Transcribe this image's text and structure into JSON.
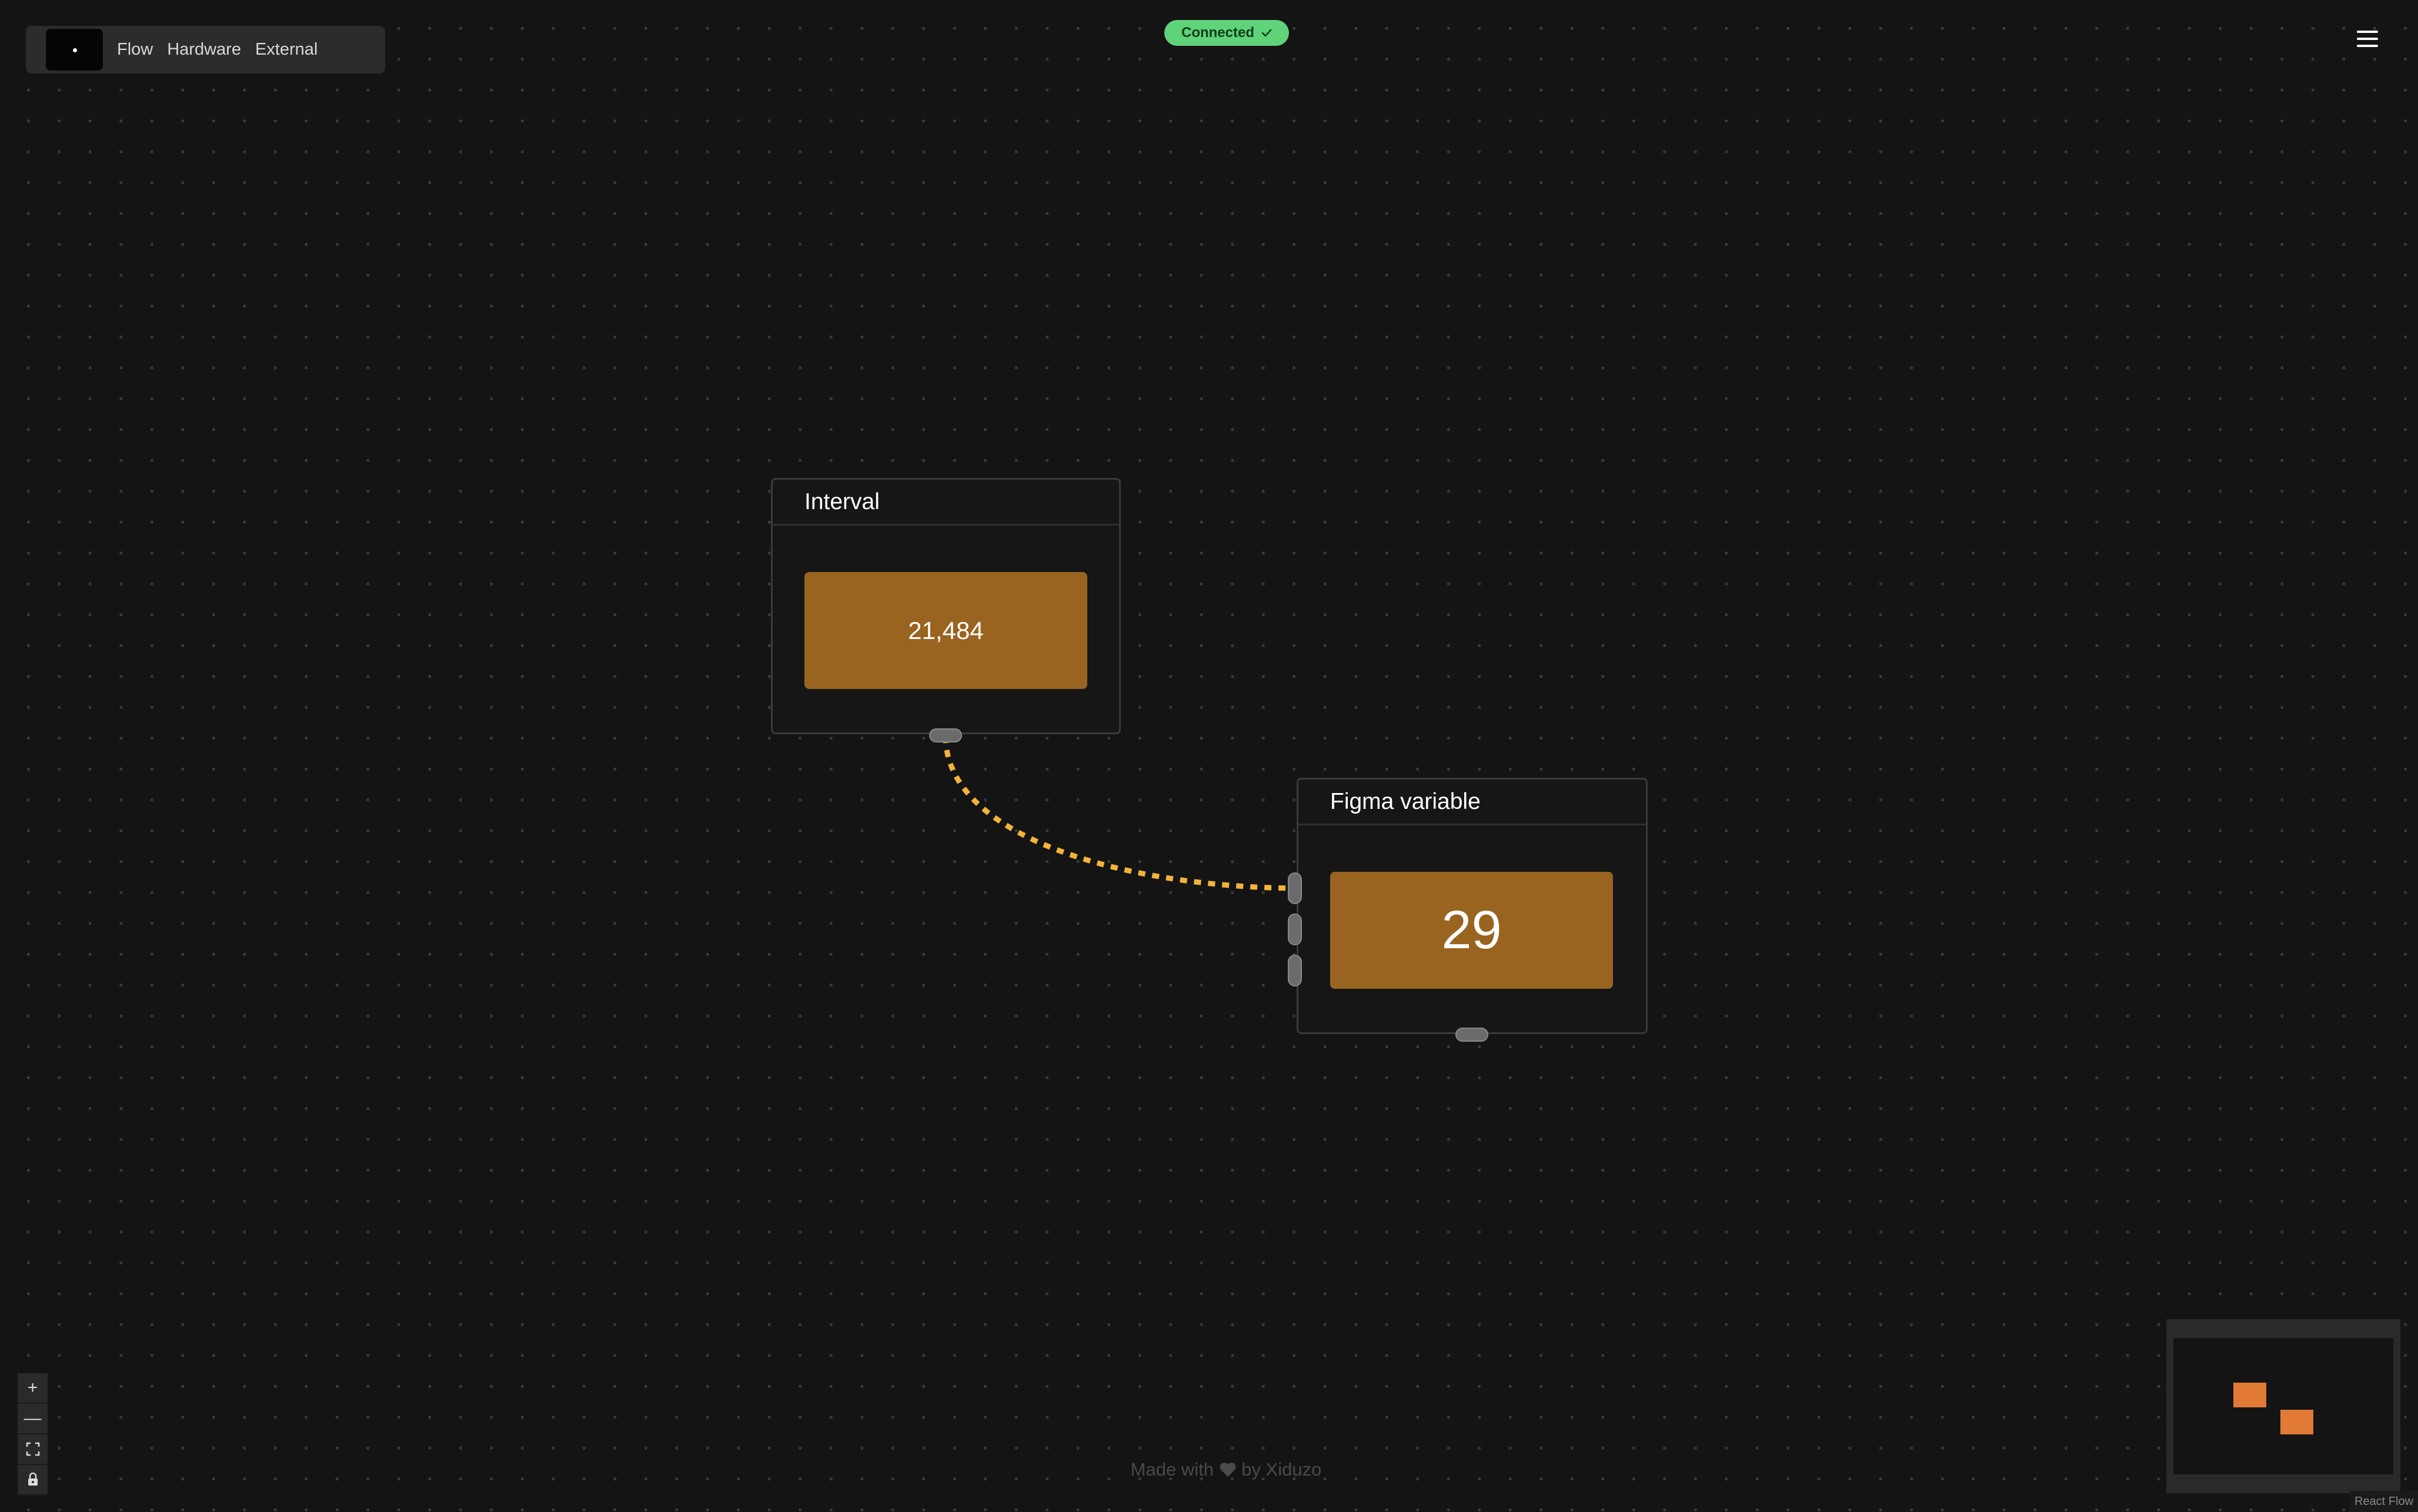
{
  "nav": {
    "links": [
      "Flow",
      "Hardware",
      "External"
    ]
  },
  "status": {
    "label": "Connected",
    "color": "#5fd27a"
  },
  "nodes": [
    {
      "title": "Interval",
      "value": "21,484",
      "color": "#996420"
    },
    {
      "title": "Figma variable",
      "value": "29",
      "color": "#996420"
    }
  ],
  "edge": {
    "color": "#f2b33a",
    "style": "dashed"
  },
  "zoom_controls": {
    "zoom_in": "+",
    "zoom_out": "—",
    "fit": "⛶",
    "lock": "🔒"
  },
  "footer": {
    "made_with": "Made with",
    "by": "by Xiduzo"
  },
  "minimap": {
    "node_color": "#e07a35"
  },
  "attribution": "React Flow",
  "icons": {
    "logo": "logo-icon",
    "menu": "hamburger-menu-icon",
    "check": "check-icon",
    "heart": "heart-icon"
  }
}
